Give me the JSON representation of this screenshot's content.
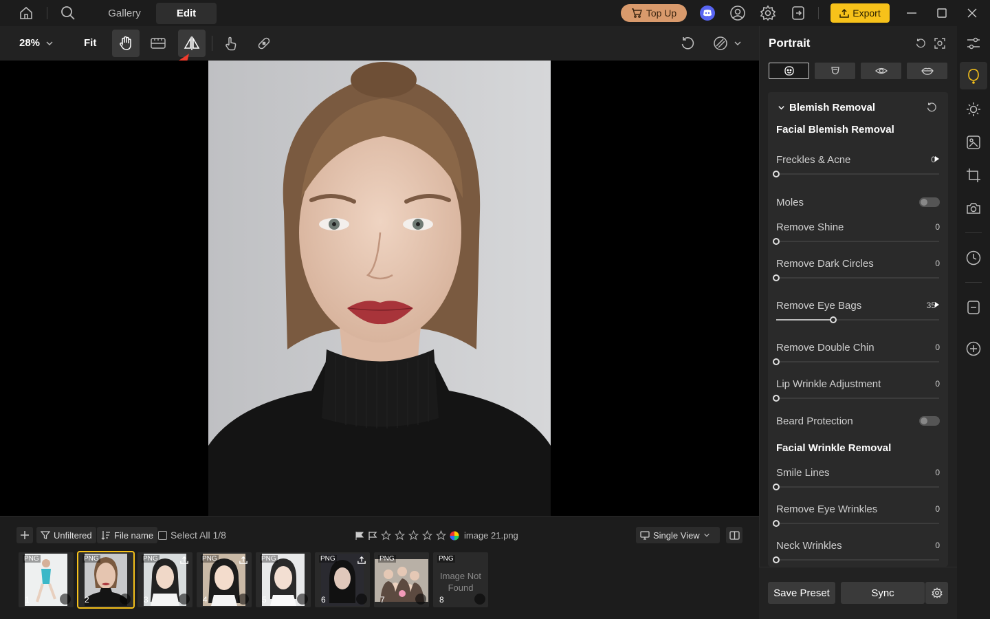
{
  "topbar": {
    "tabs": [
      {
        "label": "Gallery"
      },
      {
        "label": "Edit"
      }
    ],
    "topup_label": "Top Up",
    "export_label": "Export"
  },
  "toolbar": {
    "zoom": "28%",
    "fit_label": "Fit"
  },
  "filmstrip": {
    "filter_label": "Unfiltered",
    "sort_label": "File name",
    "select_all_label": "Select All 1/8",
    "current_file": "image 21.png",
    "view_label": "Single View",
    "thumbs": [
      {
        "tag": "PNG",
        "num": "1"
      },
      {
        "tag": "PNG",
        "num": "2"
      },
      {
        "tag": "PNG",
        "num": "3"
      },
      {
        "tag": "PNG",
        "num": "4"
      },
      {
        "tag": "PNG",
        "num": "5"
      },
      {
        "tag": "PNG",
        "num": "6"
      },
      {
        "tag": "PNG",
        "num": "7"
      },
      {
        "tag": "PNG",
        "num": "8",
        "missing": "Image Not Found"
      }
    ]
  },
  "panel": {
    "title": "Portrait",
    "section_title": "Blemish Removal",
    "group1": "Facial Blemish Removal",
    "group2": "Facial Wrinkle Removal",
    "sliders": [
      {
        "label": "Freckles & Acne",
        "value": "0",
        "level": 0
      },
      {
        "label": "Moles",
        "toggle": true
      },
      {
        "label": "Remove Shine",
        "value": "0",
        "level": 0
      },
      {
        "label": "Remove Dark Circles",
        "value": "0",
        "level": 0
      },
      {
        "label": "Remove Eye Bags",
        "value": "35",
        "level": 0.35
      },
      {
        "label": "Remove Double Chin",
        "value": "0",
        "level": 0
      },
      {
        "label": "Lip Wrinkle Adjustment",
        "value": "0",
        "level": 0
      },
      {
        "label": "Beard Protection",
        "toggle": true
      },
      {
        "label": "Smile Lines",
        "value": "0",
        "level": 0
      },
      {
        "label": "Remove Eye Wrinkles",
        "value": "0",
        "level": 0
      },
      {
        "label": "Neck Wrinkles",
        "value": "0",
        "level": 0
      }
    ],
    "save_preset_label": "Save Preset",
    "sync_label": "Sync"
  },
  "colors": {
    "accent": "#f7c21a",
    "topup": "#d99a6c",
    "discord": "#5865f2"
  }
}
